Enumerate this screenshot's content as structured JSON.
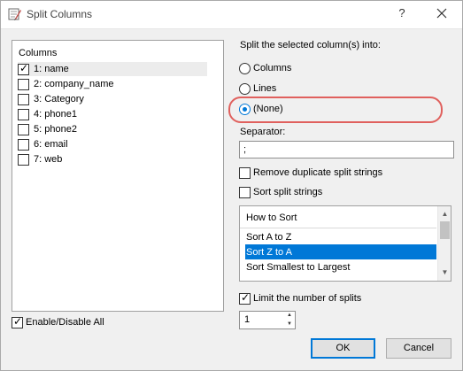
{
  "window": {
    "title": "Split Columns",
    "help_label": "?"
  },
  "columns": {
    "header": "Columns",
    "items": [
      {
        "label": "1: name",
        "checked": true
      },
      {
        "label": "2: company_name",
        "checked": false
      },
      {
        "label": "3: Category",
        "checked": false
      },
      {
        "label": "4: phone1",
        "checked": false
      },
      {
        "label": "5: phone2",
        "checked": false
      },
      {
        "label": "6: email",
        "checked": false
      },
      {
        "label": "7: web",
        "checked": false
      }
    ],
    "enable_all_label": "Enable/Disable All",
    "enable_all_checked": true
  },
  "split": {
    "heading": "Split the selected column(s) into:",
    "options": [
      {
        "label": "Columns",
        "selected": false
      },
      {
        "label": "Lines",
        "selected": false
      },
      {
        "label": "(None)",
        "selected": true
      }
    ],
    "highlight_color": "#e0605d"
  },
  "separator": {
    "label": "Separator:",
    "value": ";"
  },
  "options": {
    "remove_duplicates_label": "Remove duplicate split strings",
    "remove_duplicates_checked": false,
    "sort_label": "Sort split strings",
    "sort_checked": false
  },
  "sort_list": {
    "header": "How to Sort",
    "items": [
      "Sort A to Z",
      "Sort Z to A",
      "Sort Smallest to Largest"
    ],
    "selected_index": 1
  },
  "limit": {
    "label": "Limit the number of splits",
    "checked": true,
    "value": "1"
  },
  "buttons": {
    "ok": "OK",
    "cancel": "Cancel"
  },
  "colors": {
    "accent": "#0078d7",
    "selection": "#0078d7"
  }
}
